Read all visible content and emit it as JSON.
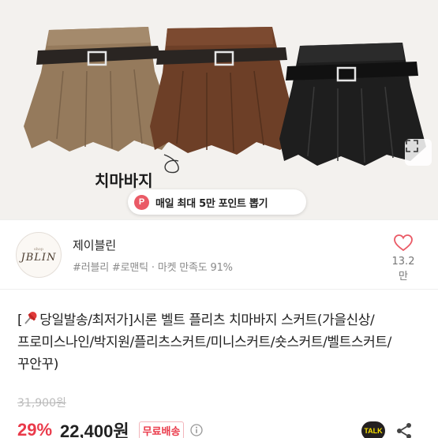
{
  "hero": {
    "alt_caption": "치마바지",
    "colors": {
      "beige": "#957a5c",
      "brown": "#6d3f27",
      "black": "#1e1e1e",
      "belt": "#2a2522"
    }
  },
  "promo": {
    "badge": "P",
    "text": "매일 최대 5만 포인트 뽑기"
  },
  "store": {
    "logo_small": "shop",
    "logo_main": "JBLIN",
    "name": "제이블린",
    "tags": "#러블리 #로맨틱",
    "satisfaction": "마켓 만족도 91%",
    "favorite_count": "13.2만"
  },
  "product": {
    "title_prefix": "[",
    "title_rest": "당일발송/최저가]시론 벨트 플리츠 치마바지 스커트(가을신상/프로미스나인/박지원/플리츠스커트/미니스커트/숏스커트/벨트스커트/꾸안꾸)",
    "original_price": "31,900원",
    "discount": "29%",
    "price": "22,400원",
    "shipping": "무료배송"
  },
  "actions": {
    "talk": "TALK"
  },
  "icons": {
    "expand": "expand-icon",
    "heart": "heart-icon",
    "pin": "pushpin-icon",
    "info": "info-icon",
    "share": "share-icon"
  },
  "accent": "#ea3a4a"
}
